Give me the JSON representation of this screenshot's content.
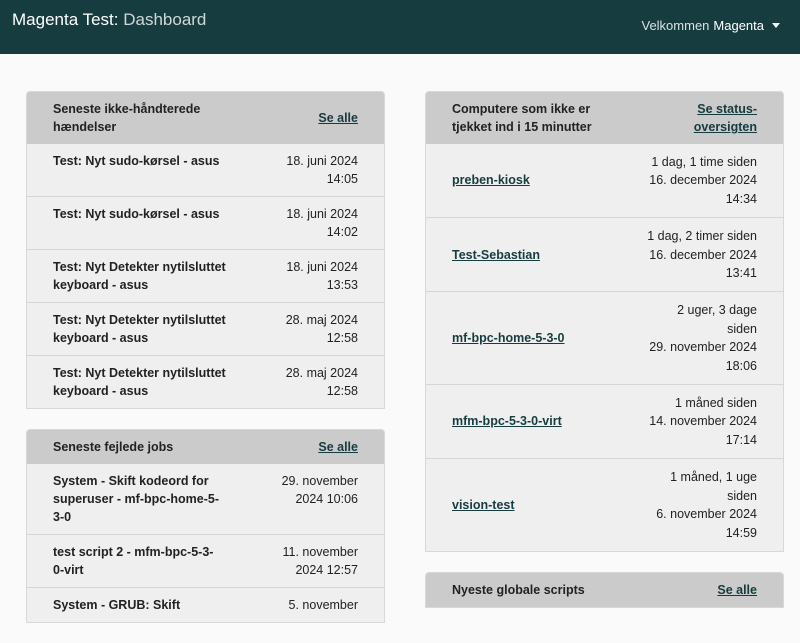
{
  "header": {
    "brand": "Magenta Test:",
    "page": "Dashboard",
    "welcome": "Velkommen",
    "user": "Magenta"
  },
  "events": {
    "title": "Seneste ikke-håndterede hændelser",
    "see_all": "Se alle",
    "rows": [
      {
        "name": "Test: Nyt sudo-kørsel - asus",
        "date": "18. juni 2024 14:05"
      },
      {
        "name": "Test: Nyt sudo-kørsel - asus",
        "date": "18. juni 2024 14:02"
      },
      {
        "name": "Test: Nyt Detekter nytilsluttet keyboard - asus",
        "date": "18. juni 2024 13:53"
      },
      {
        "name": "Test: Nyt Detekter nytilsluttet keyboard - asus",
        "date": "28. maj 2024 12:58"
      },
      {
        "name": "Test: Nyt Detekter nytilsluttet keyboard - asus",
        "date": "28. maj 2024 12:58"
      }
    ]
  },
  "jobs": {
    "title": "Seneste fejlede jobs",
    "see_all": "Se alle",
    "rows": [
      {
        "name": "System - Skift kodeord for superuser - mf-bpc-home-5-3-0",
        "date": "29. november 2024 10:06"
      },
      {
        "name": "test script 2 - mfm-bpc-5-3-0-virt",
        "date": "11. november 2024 12:57"
      },
      {
        "name": "System - GRUB: Skift",
        "date": "5. november"
      }
    ]
  },
  "computers": {
    "title": "Computere som ikke er tjekket ind i 15 minutter",
    "see_all": "Se status-oversigten",
    "rows": [
      {
        "name": "preben-kiosk",
        "ago": "1 dag, 1 time siden",
        "date": "16. december 2024 14:34"
      },
      {
        "name": "Test-Sebastian",
        "ago": "1 dag, 2 timer siden",
        "date": "16. december 2024 13:41"
      },
      {
        "name": "mf-bpc-home-5-3-0",
        "ago": "2 uger, 3 dage siden",
        "date": "29. november 2024 18:06"
      },
      {
        "name": "mfm-bpc-5-3-0-virt",
        "ago": "1 måned siden",
        "date": "14. november 2024 17:14"
      },
      {
        "name": "vision-test",
        "ago": "1 måned, 1 uge siden",
        "date": "6. november 2024 14:59"
      }
    ]
  },
  "scripts": {
    "title": "Nyeste globale scripts",
    "see_all": "Se alle"
  }
}
